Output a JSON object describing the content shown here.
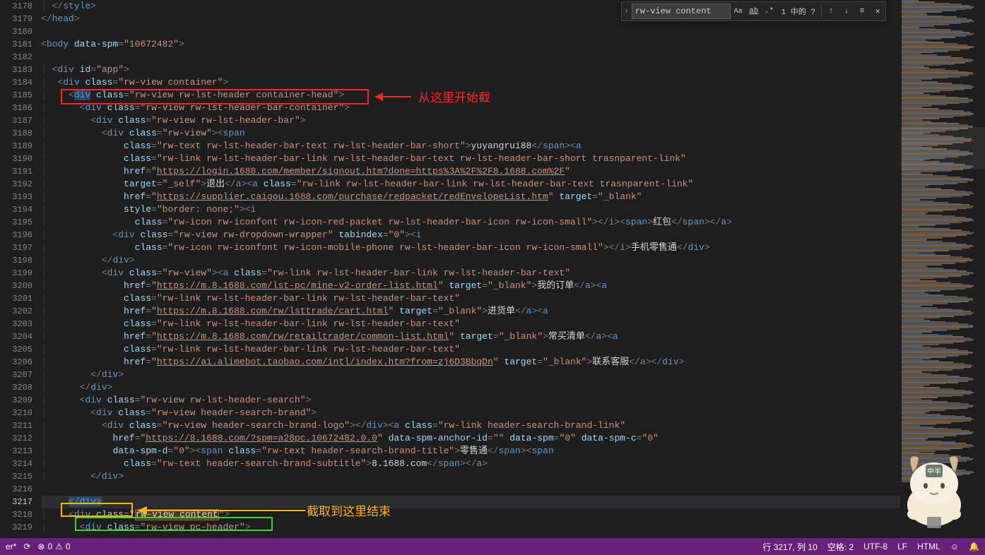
{
  "find": {
    "value": "rw-view content",
    "count_label": "1 中的 ?"
  },
  "annotations": {
    "start_label": "从这里开始截",
    "end_label": "截取到这里结束"
  },
  "line_numbers": [
    3178,
    3179,
    3180,
    3181,
    3182,
    3183,
    3184,
    3185,
    3186,
    3187,
    3188,
    3189,
    3190,
    3191,
    3192,
    3193,
    3194,
    3195,
    3196,
    3197,
    3198,
    3199,
    3200,
    3201,
    3202,
    3203,
    3204,
    3205,
    3206,
    3207,
    3208,
    3209,
    3210,
    3211,
    3212,
    3213,
    3214,
    3215,
    3216,
    3217,
    3218,
    3219
  ],
  "active_line": 3217,
  "code": {
    "l3178": {
      "text": "</style>"
    },
    "l3179": {
      "text": "</head>"
    },
    "l3181": {
      "tag": "body",
      "attr": "data-spm",
      "val": "10672482"
    },
    "l3183": {
      "tag": "div",
      "attr": "id",
      "val": "app"
    },
    "l3184": {
      "tag": "div",
      "attr": "class",
      "val": "rw-view container"
    },
    "l3185": {
      "tag": "div",
      "attr": "class",
      "val": "rw-view rw-lst-header container-head"
    },
    "l3186": {
      "tag": "div",
      "attr": "class",
      "val": "rw-view rw-lst-header-bar-container"
    },
    "l3187": {
      "tag": "div",
      "attr": "class",
      "val": "rw-view rw-lst-header-bar"
    },
    "l3188": {
      "tag": "div",
      "attr": "class",
      "val": "rw-view",
      "trail_tag": "span"
    },
    "l3189": {
      "attr": "class",
      "val": "rw-text rw-lst-header-bar-text rw-lst-header-bar-short",
      "text": "yuyangrui88",
      "close": "span",
      "trail_tag": "a"
    },
    "l3190": {
      "attr": "class",
      "val": "rw-link rw-lst-header-bar-link rw-lst-header-bar-text rw-lst-header-bar-short trasnparent-link"
    },
    "l3191": {
      "attr": "href",
      "val": "https://login.1688.com/member/signout.htm?done=https%3A%2F%2F8.1688.com%2F"
    },
    "l3192": {
      "attr": "target",
      "val": "_self",
      "text": "退出",
      "close": "a",
      "trail": "a",
      "trail_attr": "class",
      "trail_val": "rw-link rw-lst-header-bar-link rw-lst-header-bar-text trasnparent-link"
    },
    "l3193": {
      "attr": "href",
      "val": "https://supplier.caigou.1688.com/purchase/redpacket/redEnvelopeList.htm",
      "attr2": "target",
      "val2": "_blank"
    },
    "l3194": {
      "attr": "style",
      "val": "border: none;",
      "trail_tag": "i"
    },
    "l3195": {
      "attr": "class",
      "val": "rw-icon rw-iconfont rw-icon-red-packet rw-lst-header-bar-icon rw-icon-small",
      "close": "i",
      "span_text": "红包",
      "span_close": "span",
      "a_close": "a"
    },
    "l3196": {
      "tag": "div",
      "attr": "class",
      "val": "rw-view rw-dropdown-wrapper",
      "attr2": "tabindex",
      "val2": "0",
      "trail_tag": "i"
    },
    "l3197": {
      "attr": "class",
      "val": "rw-icon rw-iconfont rw-icon-mobile-phone rw-lst-header-bar-icon rw-icon-small",
      "close": "i",
      "text": "手机零售通",
      "div_close": "div"
    },
    "l3198": {
      "close": "div"
    },
    "l3199": {
      "tag": "div",
      "attr": "class",
      "val": "rw-view",
      "trail_tag": "a",
      "trail_attr": "class",
      "trail_val": "rw-link rw-lst-header-bar-link rw-lst-header-bar-text"
    },
    "l3200": {
      "attr": "href",
      "val": "https://m.8.1688.com/lst-pc/mine-v2-order-list.html",
      "attr2": "target",
      "val2": "_blank",
      "text": "我的订单",
      "close": "a",
      "trail_tag": "a"
    },
    "l3201": {
      "attr": "class",
      "val": "rw-link rw-lst-header-bar-link rw-lst-header-bar-text"
    },
    "l3202": {
      "attr": "href",
      "val": "https://m.8.1688.com/rw/lsttrade/cart.html",
      "attr2": "target",
      "val2": "_blank",
      "text": "进货单",
      "close": "a",
      "trail_tag": "a"
    },
    "l3203": {
      "attr": "class",
      "val": "rw-link rw-lst-header-bar-link rw-lst-header-bar-text"
    },
    "l3204": {
      "attr": "href",
      "val": "https://m.8.1688.com/rw/retailtrader/common-list.html",
      "attr2": "target",
      "val2": "_blank",
      "text": "常买清单",
      "close": "a",
      "trail_tag": "a"
    },
    "l3205": {
      "attr": "class",
      "val": "rw-link rw-lst-header-bar-link rw-lst-header-bar-text"
    },
    "l3206": {
      "attr": "href",
      "val": "https://ai.alimebot.taobao.com/intl/index.htm?from=zj6D3BbqDn",
      "attr2": "target",
      "val2": "_blank",
      "text": "联系客服",
      "close_seq": "a,div"
    },
    "l3207": {
      "close": "div"
    },
    "l3208": {
      "close": "div"
    },
    "l3209": {
      "tag": "div",
      "attr": "class",
      "val": "rw-view rw-lst-header-search"
    },
    "l3210": {
      "tag": "div",
      "attr": "class",
      "val": "rw-view header-search-brand"
    },
    "l3211": {
      "tag": "div",
      "attr": "class",
      "val": "rw-view header-search-brand-logo",
      "close": "div",
      "trail_tag": "a",
      "trail_attr": "class",
      "trail_val": "rw-link header-search-brand-link"
    },
    "l3212": {
      "attr": "href",
      "val": "https://8.1688.com/?spm=a28pc.10672482.0.0",
      "attr2": "data-spm-anchor-id",
      "val2": "",
      "attr3": "data-spm",
      "val3": "0",
      "attr4": "data-spm-c",
      "val4": "0"
    },
    "l3213": {
      "attr": "data-spm-d",
      "val": "0",
      "trail_tag": "span",
      "trail_attr": "class",
      "trail_val": "rw-text header-search-brand-title",
      "text": "零售通",
      "close": "span",
      "trail2": "span"
    },
    "l3214": {
      "attr": "class",
      "val": "rw-text header-search-brand-subtitle",
      "text": "8.1688.com",
      "close_seq": "span,a"
    },
    "l3215": {
      "close": "div"
    },
    "l3217": {
      "close": "div"
    },
    "l3218": {
      "tag": "div",
      "attr": "class",
      "val": "rw-view content"
    },
    "l3219": {
      "tag": "div",
      "attr": "class",
      "val": "rw-view pc-header"
    }
  },
  "statusbar": {
    "filename": "er*",
    "errors": "0",
    "warnings": "0",
    "line_col": "行 3217, 列 10",
    "spaces": "空格: 2",
    "encoding": "UTF-8",
    "eol": "LF",
    "lang": "HTML"
  }
}
